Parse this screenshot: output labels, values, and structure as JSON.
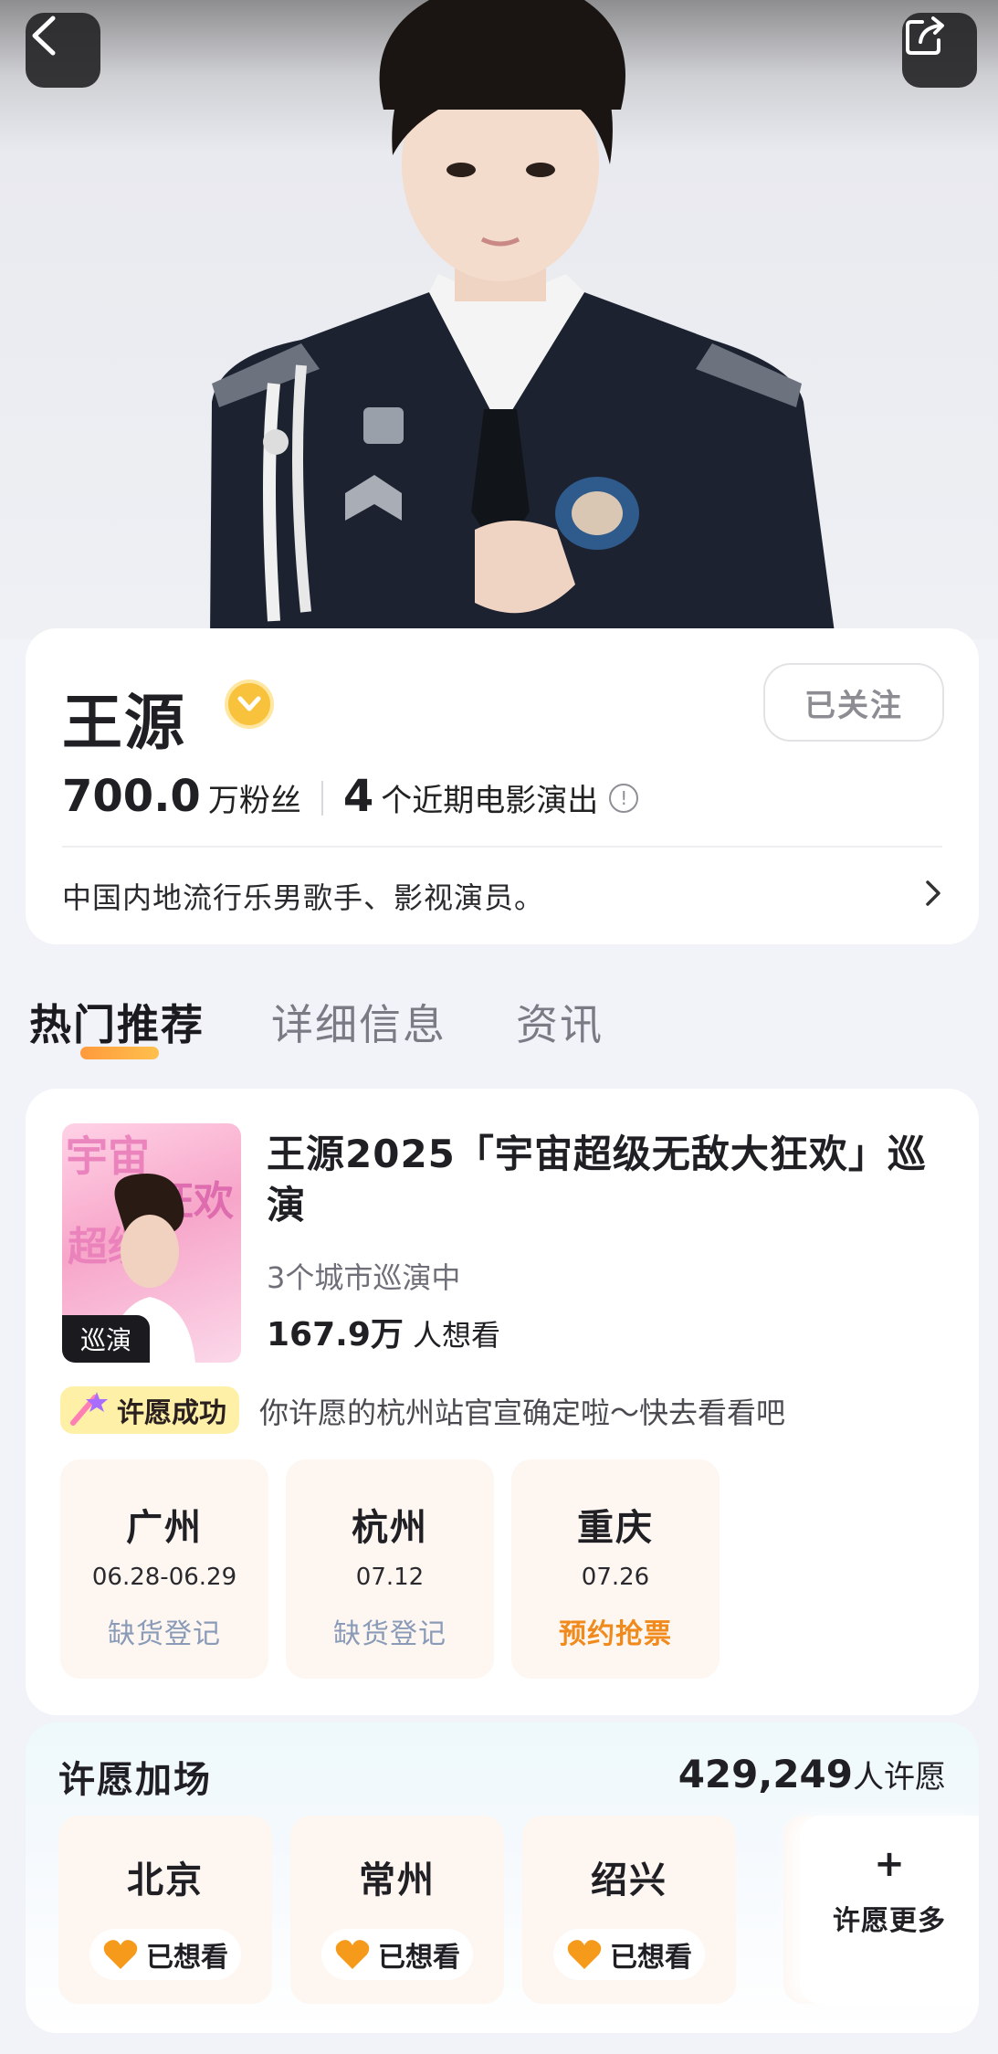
{
  "nav": {
    "back_icon": "back-chevron-icon",
    "share_icon": "share-icon"
  },
  "profile": {
    "name": "王源",
    "verified_icon": "verified-badge-icon",
    "follow_label": "已关注",
    "fans_number": "700.0",
    "fans_unit": "万粉丝",
    "shows_number": "4",
    "shows_unit": "个近期电影演出",
    "bio": "中国内地流行乐男歌手、影视演员。"
  },
  "tabs": [
    {
      "label": "热门推荐",
      "active": true
    },
    {
      "label": "详细信息",
      "active": false
    },
    {
      "label": "资讯",
      "active": false
    }
  ],
  "tour": {
    "poster_tag": "巡演",
    "title": "王源2025「宇宙超级无敌大狂欢」巡演",
    "subtitle": "3个城市巡演中",
    "want_number": "167.9万",
    "want_unit": "人想看",
    "wish_badge": "许愿成功",
    "wish_message": "你许愿的杭州站官宣确定啦～快去看看吧",
    "cities": [
      {
        "name": "广州",
        "date": "06.28-06.29",
        "status": "缺货登记",
        "highlight": false
      },
      {
        "name": "杭州",
        "date": "07.12",
        "status": "缺货登记",
        "highlight": false
      },
      {
        "name": "重庆",
        "date": "07.26",
        "status": "预约抢票",
        "highlight": true
      }
    ]
  },
  "wish": {
    "title": "许愿加场",
    "count_number": "429,249",
    "count_unit": "人许愿",
    "cities": [
      {
        "name": "北京",
        "state": "已想看"
      },
      {
        "name": "常州",
        "state": "已想看"
      },
      {
        "name": "绍兴",
        "state": "已想看"
      }
    ],
    "more_plus": "+",
    "more_label": "许愿更多"
  },
  "colors": {
    "accent_orange": "#f08a1c",
    "badge_yellow": "#f9c23c",
    "muted_blue": "#8a9bb8"
  }
}
